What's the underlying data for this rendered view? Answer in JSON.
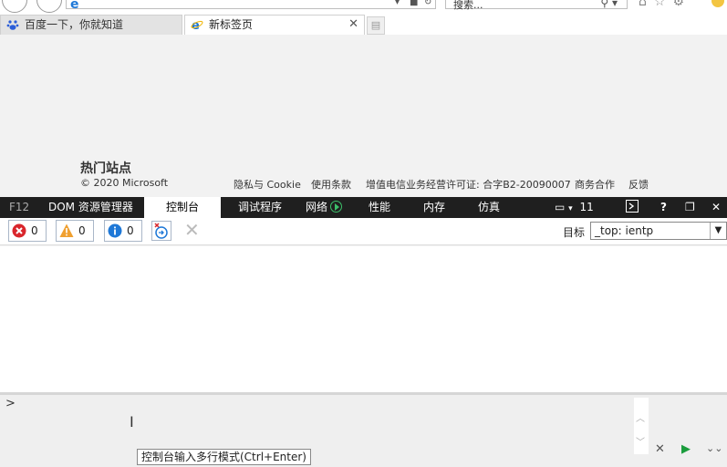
{
  "browser": {
    "search_placeholder": "搜索...",
    "tabs": [
      {
        "title": "百度一下，你就知道"
      },
      {
        "title": "新标签页"
      }
    ]
  },
  "page": {
    "section_heading": "热门站点",
    "copyright": "© 2020 Microsoft",
    "footer_links": [
      "隐私与 Cookie",
      "使用条款",
      "增值电信业务经营许可证: 合字B2-20090007",
      "商务合作",
      "反馈"
    ]
  },
  "devtools": {
    "tabs": [
      "F12",
      "DOM 资源管理器",
      "控制台",
      "调试程序",
      "网络",
      "性能",
      "内存",
      "仿真"
    ],
    "active_tab": "控制台",
    "emulation_version": "11",
    "help": "?",
    "console": {
      "error_count": "0",
      "warning_count": "0",
      "info_count": "0",
      "target_label": "目标",
      "target_value": "_top: ientp",
      "prompt": ">",
      "tooltip": "控制台输入多行模式(Ctrl+Enter)"
    }
  },
  "colors": {
    "devtools_bar": "#1f1f1f",
    "error": "#d9262c",
    "warning": "#f0a030",
    "info": "#1e78d7",
    "run": "#1a9c3c"
  }
}
